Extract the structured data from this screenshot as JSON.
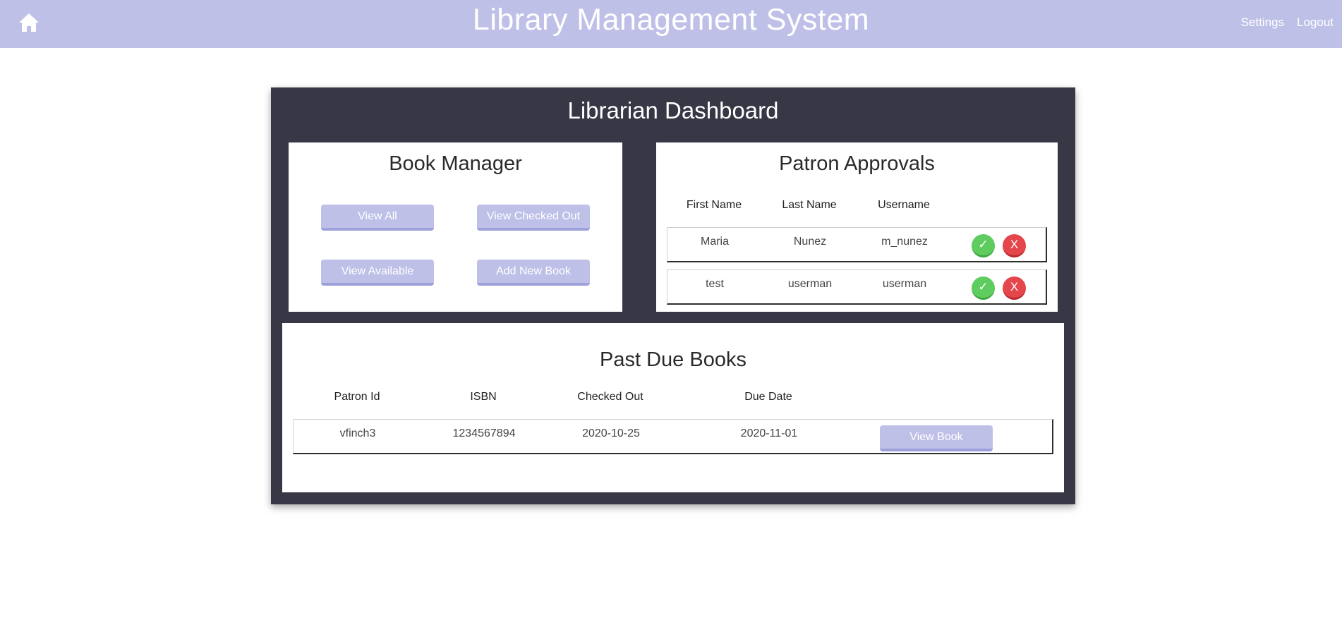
{
  "header": {
    "title": "Library Management System",
    "home_icon": "home-icon",
    "nav": {
      "settings": "Settings",
      "logout": "Logout"
    }
  },
  "colors": {
    "topbar": "#bfc0e8",
    "panel": "#373745",
    "approve": "#5fcc5f",
    "reject": "#e4474b"
  },
  "dashboard": {
    "title": "Librarian Dashboard"
  },
  "book_manager": {
    "title": "Book Manager",
    "buttons": {
      "view_all": "View All",
      "view_checked_out": "View Checked Out",
      "view_available": "View Available",
      "add_new_book": "Add New Book"
    }
  },
  "patron_approvals": {
    "title": "Patron Approvals",
    "columns": [
      "First Name",
      "Last Name",
      "Username"
    ],
    "rows": [
      {
        "first": "Maria",
        "last": "Nunez",
        "username": "m_nunez",
        "approve": "✓",
        "reject": "X"
      },
      {
        "first": "test",
        "last": "userman",
        "username": "userman",
        "approve": "✓",
        "reject": "X"
      }
    ]
  },
  "past_due": {
    "title": "Past Due Books",
    "columns": [
      "Patron Id",
      "ISBN",
      "Checked Out",
      "Due Date"
    ],
    "rows": [
      {
        "patron_id": "vfinch3",
        "isbn": "1234567894",
        "checked_out": "2020-10-25",
        "due_date": "2020-11-01",
        "action": "View Book"
      }
    ]
  }
}
